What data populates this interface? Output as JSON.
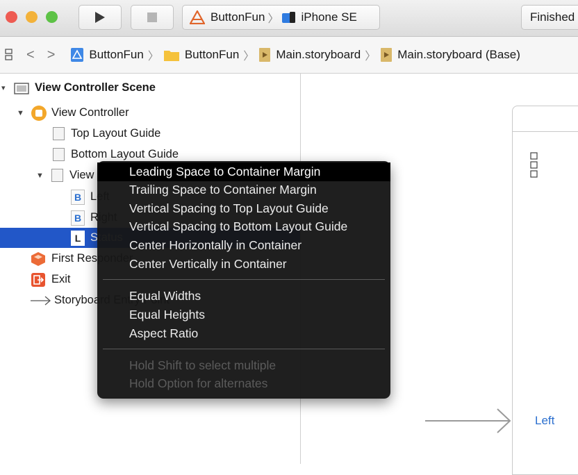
{
  "toolbar": {
    "scheme_project": "ButtonFun",
    "scheme_device": "iPhone SE",
    "activity_status": "Finished"
  },
  "jumpbar": {
    "crumbs": [
      "ButtonFun",
      "ButtonFun",
      "Main.storyboard",
      "Main.storyboard (Base)"
    ]
  },
  "outline": {
    "scene_title": "View Controller Scene",
    "view_controller": "View Controller",
    "top_layout_guide": "Top Layout Guide",
    "bottom_layout_guide": "Bottom Layout Guide",
    "view": "View",
    "button_left": "Left",
    "button_right": "Right",
    "label_status": "Status",
    "first_responder": "First Responder",
    "exit": "Exit",
    "storyboard_entry": "Storyboard Entry Point"
  },
  "context_menu": {
    "group1": [
      "Leading Space to Container Margin",
      "Trailing Space to Container Margin",
      "Vertical Spacing to Top Layout Guide",
      "Vertical Spacing to Bottom Layout Guide",
      "Center Horizontally in Container",
      "Center Vertically in Container"
    ],
    "group2": [
      "Equal Widths",
      "Equal Heights",
      "Aspect Ratio"
    ],
    "hints": [
      "Hold Shift to select multiple",
      "Hold Option for alternates"
    ]
  },
  "canvas": {
    "left_button": "Left"
  },
  "colors": {
    "selection": "#2257c8",
    "close": "#ee5b52",
    "minimize": "#f3b23a",
    "zoom": "#5dc246",
    "link_blue": "#2b6fcf",
    "menu_bg": "#161616"
  }
}
